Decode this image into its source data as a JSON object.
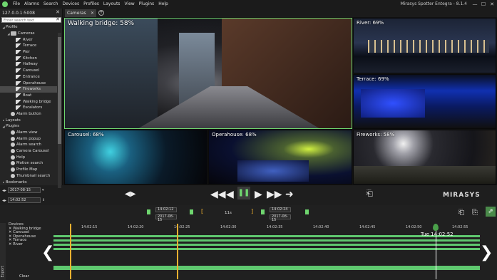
{
  "menubar": {
    "items": [
      "File",
      "Alarms",
      "Search",
      "Devices",
      "Profiles",
      "Layouts",
      "View",
      "Plugins",
      "Help"
    ],
    "title": "Mirasys Spotter Entegra - 8.1.4",
    "minimize": "—",
    "maximize": "☐",
    "close": "✕"
  },
  "leftpanel": {
    "server": "127.0.0.1:5008",
    "close": "✕",
    "search_placeholder": "Enter search text",
    "search_clear": "✕",
    "tree": [
      {
        "label": "Profile",
        "indent": 0,
        "tri": "◢",
        "icon": "none"
      },
      {
        "label": "Cameras",
        "indent": 1,
        "tri": "◢",
        "icon": "folder"
      },
      {
        "label": "River",
        "indent": 2,
        "tri": "",
        "icon": "cam"
      },
      {
        "label": "Terrace",
        "indent": 2,
        "tri": "",
        "icon": "cam"
      },
      {
        "label": "Pier",
        "indent": 2,
        "tri": "",
        "icon": "cam"
      },
      {
        "label": "Kitchen",
        "indent": 2,
        "tri": "",
        "icon": "cam"
      },
      {
        "label": "Hallway",
        "indent": 2,
        "tri": "",
        "icon": "cam"
      },
      {
        "label": "Carousel",
        "indent": 2,
        "tri": "",
        "icon": "cam"
      },
      {
        "label": "Entrance",
        "indent": 2,
        "tri": "",
        "icon": "cam"
      },
      {
        "label": "Operahouse",
        "indent": 2,
        "tri": "",
        "icon": "cam"
      },
      {
        "label": "Fireworks",
        "indent": 2,
        "tri": "",
        "icon": "cam",
        "selected": true
      },
      {
        "label": "Boat",
        "indent": 2,
        "tri": "",
        "icon": "cam"
      },
      {
        "label": "Walking bridge",
        "indent": 2,
        "tri": "",
        "icon": "cam"
      },
      {
        "label": "Escalators",
        "indent": 2,
        "tri": "",
        "icon": "cam"
      },
      {
        "label": "Alarm button",
        "indent": 1,
        "tri": "",
        "icon": "plug"
      },
      {
        "label": "Layouts",
        "indent": 0,
        "tri": "▸",
        "icon": "none"
      },
      {
        "label": "Plugins",
        "indent": 0,
        "tri": "◢",
        "icon": "none"
      },
      {
        "label": "Alarm view",
        "indent": 1,
        "tri": "",
        "icon": "plug"
      },
      {
        "label": "Alarm popup",
        "indent": 1,
        "tri": "",
        "icon": "plug"
      },
      {
        "label": "Alarm search",
        "indent": 1,
        "tri": "",
        "icon": "plug"
      },
      {
        "label": "Camera Carousel",
        "indent": 1,
        "tri": "",
        "icon": "plug"
      },
      {
        "label": "Help",
        "indent": 1,
        "tri": "",
        "icon": "plug"
      },
      {
        "label": "Motion search",
        "indent": 1,
        "tri": "",
        "icon": "plug"
      },
      {
        "label": "Profile Map",
        "indent": 1,
        "tri": "",
        "icon": "plug"
      },
      {
        "label": "Thumbnail search",
        "indent": 1,
        "tri": "",
        "icon": "plug"
      },
      {
        "label": "Bookmarks",
        "indent": 0,
        "tri": "▸",
        "icon": "none"
      }
    ],
    "date": "2017-08-15",
    "time": "14:02:52"
  },
  "tabs": {
    "cameras": "Cameras",
    "close": "✕",
    "add": "+"
  },
  "tiles": [
    {
      "label": "Walking bridge: 58%",
      "name": "walking-bridge"
    },
    {
      "label": "River: 69%",
      "name": "river"
    },
    {
      "label": "Terrace: 69%",
      "name": "terrace"
    },
    {
      "label": "Carousel: 68%",
      "name": "carousel"
    },
    {
      "label": "Operahouse: 68%",
      "name": "operahouse"
    },
    {
      "label": "Fireworks: 58%",
      "name": "fireworks"
    }
  ],
  "transport": {
    "prev_frame": "◀▶",
    "rewind": "◀◀",
    "back": "◀",
    "pause": "❚❚",
    "forward": "▶",
    "fastforward": "▶▶",
    "live": "➜",
    "bookmark": "🔖",
    "brand": "MIRASYS"
  },
  "timeline": {
    "start_time": "14:02:12",
    "start_date": "2017-08-15",
    "duration": "11s",
    "end_time": "14:02:24",
    "end_date": "2017-08-15",
    "ticks": [
      "14:02:15",
      "14:02:20",
      "14:02:25",
      "14:02:30",
      "14:02:35",
      "14:02:40",
      "14:02:45",
      "14:02:50",
      "14:02:55"
    ],
    "devices_header": "Devices",
    "devices": [
      "Walking bridge",
      "Carousel",
      "Operahouse",
      "Terrace",
      "River"
    ],
    "export_label": "Export",
    "clear": "Clear",
    "playhead": "Tue 14:02:52",
    "nav_left": "❮",
    "nav_right": "❯"
  }
}
